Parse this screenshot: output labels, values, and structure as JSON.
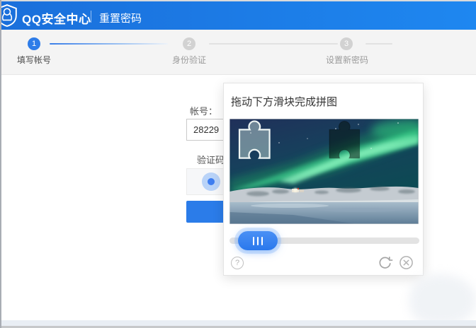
{
  "header": {
    "logo_icon": "qq-shield-penguin-icon",
    "title": "QQ安全中心",
    "subtitle": "重置密码"
  },
  "steps": {
    "items": [
      {
        "number": "1",
        "label": "填写帐号",
        "state": "active"
      },
      {
        "number": "2",
        "label": "身份验证",
        "state": "inactive"
      },
      {
        "number": "3",
        "label": "设置新密码",
        "state": "inactive"
      }
    ]
  },
  "form": {
    "account_label": "帐号：",
    "account_value": "28229",
    "captcha_label": "验证码"
  },
  "popup": {
    "title": "拖动下方滑块完成拼图",
    "image_description": "aurora-borealis-over-snowy-hills-and-frozen-lake-with-jigsaw-piece-and-target-hole",
    "help_glyph": "?",
    "refresh_icon": "circular-arrow-refresh-icon",
    "close_icon": "x-in-circle-close-icon",
    "slider_grip": "three-vertical-bars"
  },
  "colors": {
    "header_blue_start": "#1a6fdb",
    "header_blue_end": "#1e87f0",
    "step_active_blue": "#2e7ce8",
    "step_inactive_gray": "#d2d2d2",
    "button_blue": "#2b7ce9",
    "knob_blue": "#3b82f0",
    "track_gray": "#e3e3e3"
  }
}
